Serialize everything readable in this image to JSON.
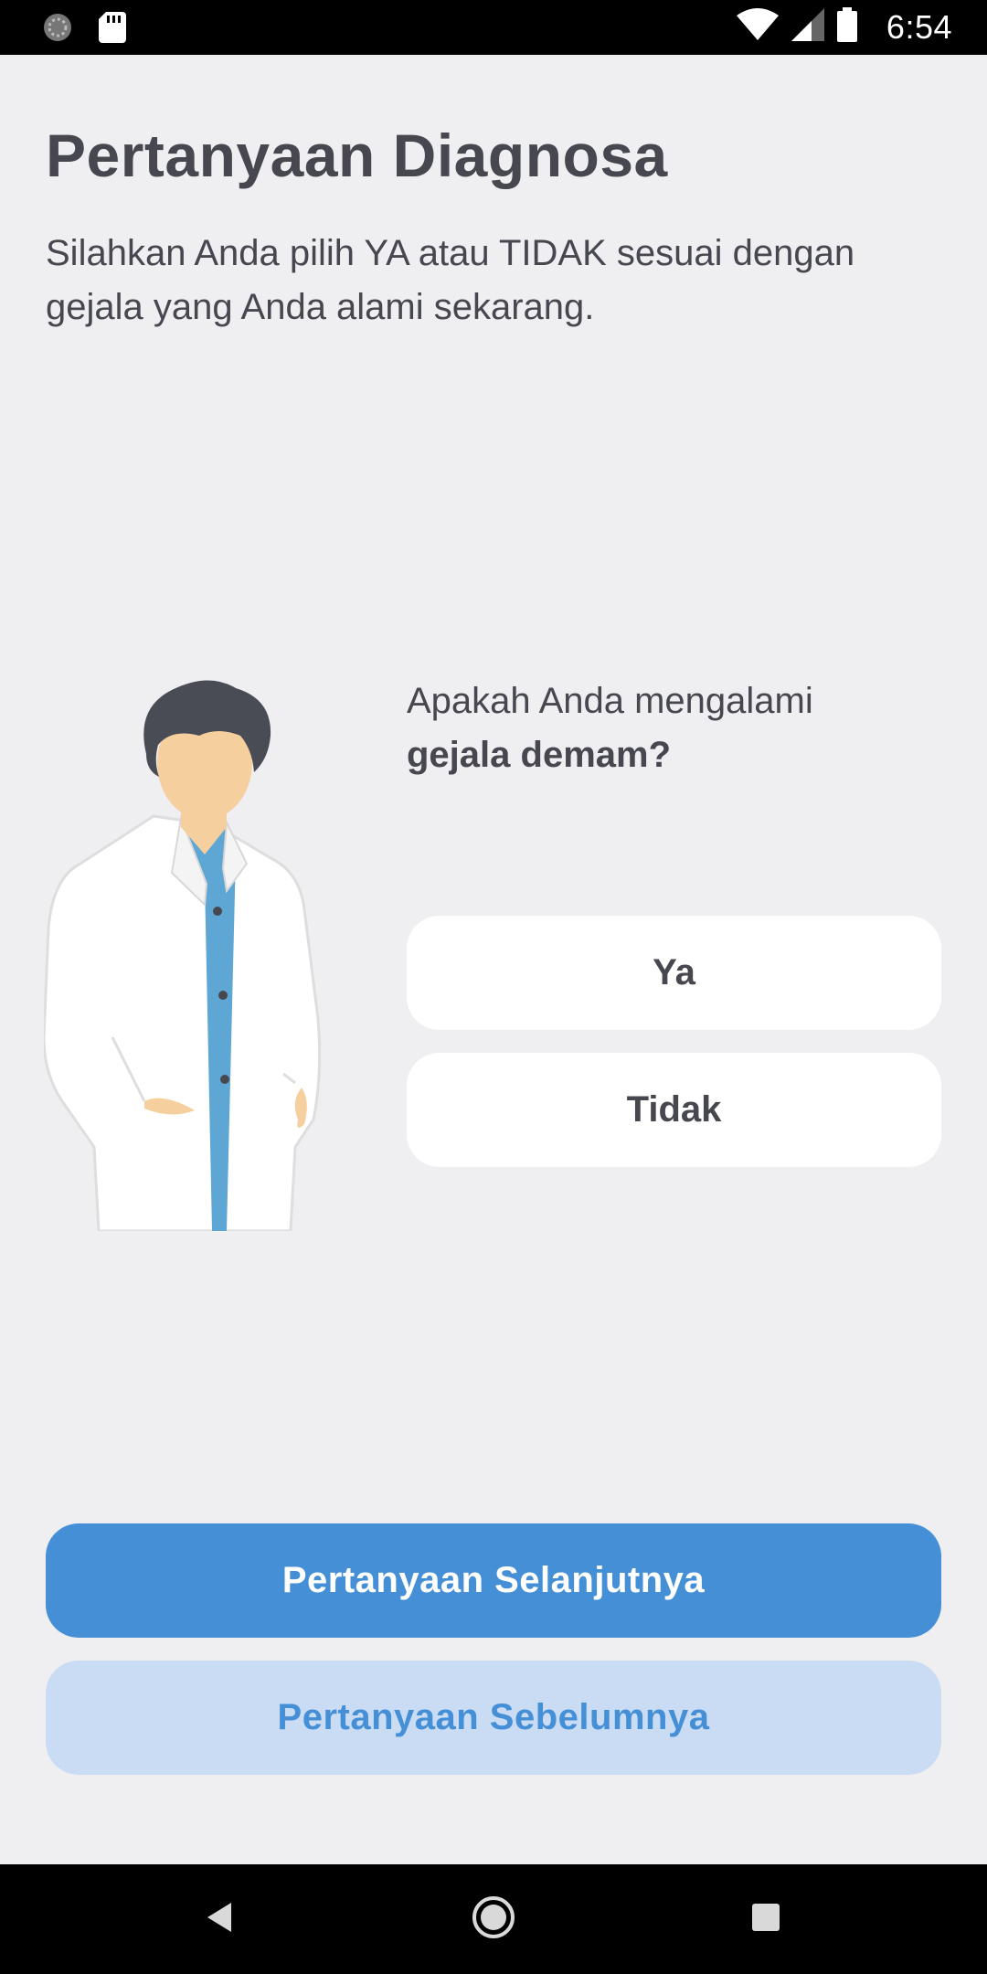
{
  "status_bar": {
    "time": "6:54",
    "icons": [
      "sync-icon",
      "sd-card-icon",
      "wifi-icon",
      "cell-signal-icon",
      "battery-icon"
    ]
  },
  "header": {
    "title": "Pertanyaan Diagnosa",
    "subtitle": "Silahkan Anda pilih YA atau TIDAK sesuai dengan gejala yang Anda alami sekarang."
  },
  "question": {
    "prefix": "Apakah Anda mengalami",
    "emphasis": "gejala demam?"
  },
  "answers": {
    "yes_label": "Ya",
    "no_label": "Tidak"
  },
  "navigation": {
    "next_label": "Pertanyaan Selanjutnya",
    "prev_label": "Pertanyaan Sebelumnya"
  },
  "colors": {
    "background": "#efeff2",
    "primary": "#458fd6",
    "secondary_bg": "#cadcf4",
    "text": "#474750"
  },
  "system_nav": {
    "icons": [
      "back-icon",
      "home-icon",
      "recents-icon"
    ]
  }
}
